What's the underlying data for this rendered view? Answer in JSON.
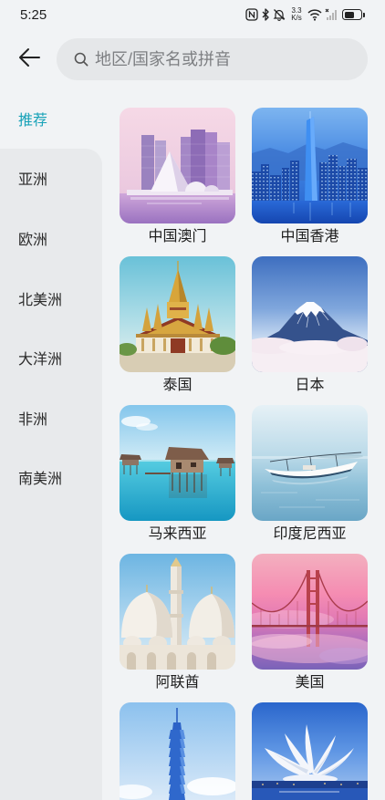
{
  "status_bar": {
    "time": "5:25",
    "net_speed": "3.3",
    "net_unit": "K/s",
    "battery_level": 0.62
  },
  "search": {
    "placeholder": "地区/国家名或拼音"
  },
  "colors": {
    "accent": "#18a2b8",
    "page_bg": "#f1f3f5",
    "sidebar_bg": "#e8eaec",
    "search_bg": "#e5e7e9",
    "label_text": "#1e1e1e"
  },
  "sidebar": {
    "items": [
      {
        "label": "推荐",
        "selected": true
      },
      {
        "label": "亚洲",
        "selected": false
      },
      {
        "label": "欧洲",
        "selected": false
      },
      {
        "label": "北美洲",
        "selected": false
      },
      {
        "label": "大洋洲",
        "selected": false
      },
      {
        "label": "非洲",
        "selected": false
      },
      {
        "label": "南美洲",
        "selected": false
      }
    ]
  },
  "destinations": [
    {
      "name": "中国澳门"
    },
    {
      "name": "中国香港"
    },
    {
      "name": "泰国"
    },
    {
      "name": "日本"
    },
    {
      "name": "马来西亚"
    },
    {
      "name": "印度尼西亚"
    },
    {
      "name": "阿联酋"
    },
    {
      "name": "美国"
    }
  ]
}
